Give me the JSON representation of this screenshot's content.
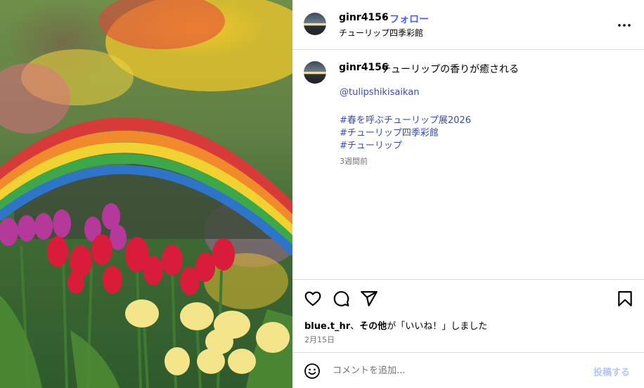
{
  "post": {
    "username": "ginr4156",
    "separator": "•",
    "follow_label": "フォロー",
    "location": "チューリップ四季彩館"
  },
  "caption": {
    "username": "ginr4156",
    "text": "チューリップの香りが癒される",
    "lines": [
      "@tulipshikisaikan",
      "",
      "#春を呼ぶチューリップ展2026",
      "#チューリップ四季彩館",
      "#チューリップ"
    ],
    "time": "3週間前"
  },
  "actions": {
    "icons": [
      "heart-icon",
      "comment-icon",
      "share-icon",
      "bookmark-icon"
    ]
  },
  "likes": {
    "user": "blue.t_hr",
    "sep": "、",
    "others": "その他",
    "suffix": "が「いいね！」しました"
  },
  "date": "2月15日",
  "comment": {
    "placeholder": "コメントを追加...",
    "post_label": "投稿する"
  },
  "colors": {
    "follow": "#4a5df9",
    "link": "#3b4bb3",
    "post_disabled": "#b3c6f7",
    "divider": "#dbdbdb"
  }
}
